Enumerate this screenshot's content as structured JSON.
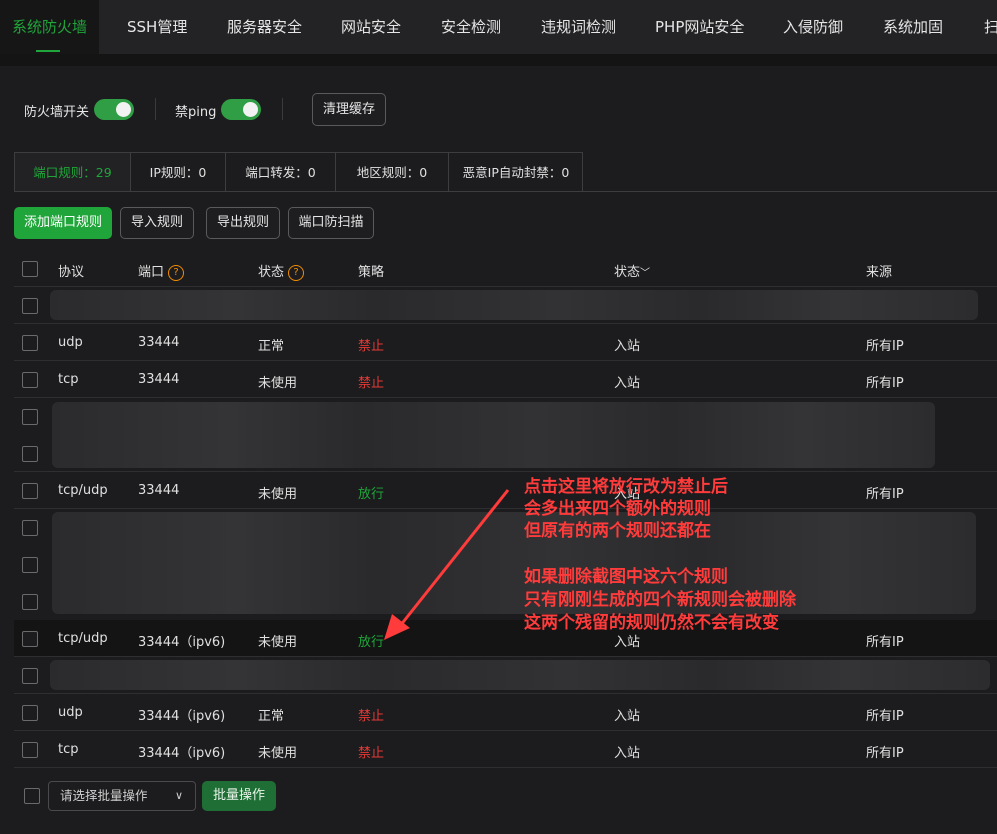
{
  "top_tabs": [
    "系统防火墙",
    "SSH管理",
    "服务器安全",
    "网站安全",
    "安全检测",
    "违规词检测",
    "PHP网站安全",
    "入侵防御",
    "系统加固",
    "扫"
  ],
  "switches": {
    "firewall_label": "防火墙开关",
    "ping_label": "禁ping",
    "clear_cache": "清理缓存"
  },
  "rule_tabs": [
    "端口规则：29",
    "IP规则：0",
    "端口转发：0",
    "地区规则：0",
    "恶意IP自动封禁：0"
  ],
  "actions": {
    "add": "添加端口规则",
    "import": "导入规则",
    "export": "导出规则",
    "scan": "端口防扫描"
  },
  "table": {
    "headers": [
      "协议",
      "端口",
      "状态",
      "策略",
      "状态",
      "来源"
    ],
    "help_glyph": "?",
    "sort_glyph": "﹀",
    "rows": [
      {
        "protocol": "udp",
        "port": "33444",
        "status": "正常",
        "policy": "禁止",
        "direction": "入站",
        "source": "所有IP"
      },
      {
        "protocol": "tcp",
        "port": "33444",
        "status": "未使用",
        "policy": "禁止",
        "direction": "入站",
        "source": "所有IP"
      },
      {
        "protocol": "tcp/udp",
        "port": "33444",
        "status": "未使用",
        "policy": "放行",
        "direction": "入站",
        "source": "所有IP"
      },
      {
        "protocol": "tcp/udp",
        "port": "33444（ipv6)",
        "status": "未使用",
        "policy": "放行",
        "direction": "入站",
        "source": "所有IP"
      },
      {
        "protocol": "udp",
        "port": "33444（ipv6)",
        "status": "正常",
        "policy": "禁止",
        "direction": "入站",
        "source": "所有IP"
      },
      {
        "protocol": "tcp",
        "port": "33444（ipv6)",
        "status": "未使用",
        "policy": "禁止",
        "direction": "入站",
        "source": "所有IP"
      }
    ]
  },
  "annotation": {
    "lines": [
      "点击这里将放行改为禁止后",
      "会多出来四个额外的规则",
      "但原有的两个规则还都在",
      "如果删除截图中这六个规则",
      "只有刚刚生成的四个新规则会被删除",
      "这两个残留的规则仍然不会有改变"
    ],
    "color": "#ff3b3b"
  },
  "bottom": {
    "select_placeholder": "请选择批量操作",
    "batch_button": "批量操作"
  },
  "colors": {
    "accent": "#20a53a",
    "deny": "#e53935",
    "allow": "#20a53a",
    "help": "#f08c00"
  }
}
